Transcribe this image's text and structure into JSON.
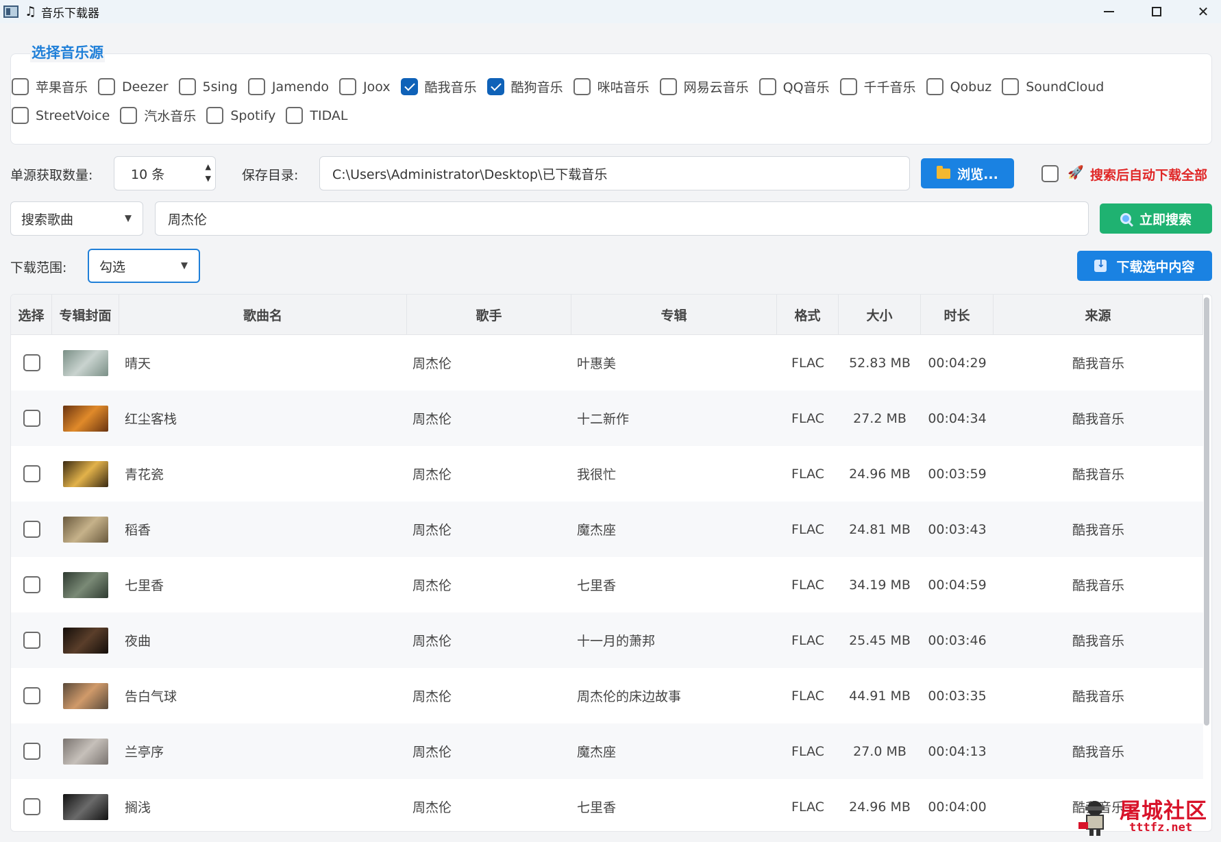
{
  "window": {
    "title": "音乐下载器"
  },
  "sources": {
    "title": "选择音乐源",
    "items": [
      {
        "label": "苹果音乐",
        "checked": false
      },
      {
        "label": "Deezer",
        "checked": false
      },
      {
        "label": "5sing",
        "checked": false
      },
      {
        "label": "Jamendo",
        "checked": false
      },
      {
        "label": "Joox",
        "checked": false
      },
      {
        "label": "酷我音乐",
        "checked": true
      },
      {
        "label": "酷狗音乐",
        "checked": true
      },
      {
        "label": "咪咕音乐",
        "checked": false
      },
      {
        "label": "网易云音乐",
        "checked": false
      },
      {
        "label": "QQ音乐",
        "checked": false
      },
      {
        "label": "千千音乐",
        "checked": false
      },
      {
        "label": "Qobuz",
        "checked": false
      },
      {
        "label": "SoundCloud",
        "checked": false
      },
      {
        "label": "StreetVoice",
        "checked": false
      },
      {
        "label": "汽水音乐",
        "checked": false
      },
      {
        "label": "Spotify",
        "checked": false
      },
      {
        "label": "TIDAL",
        "checked": false
      }
    ]
  },
  "settings": {
    "count_label": "单源获取数量:",
    "count_value": "10 条",
    "dir_label": "保存目录:",
    "dir_value": "C:\\Users\\Administrator\\Desktop\\已下载音乐",
    "browse_label": "浏览...",
    "auto_download_label": "搜索后自动下载全部",
    "auto_download_checked": false
  },
  "search": {
    "type_value": "搜索歌曲",
    "query": "周杰伦",
    "search_button": "立即搜索"
  },
  "download": {
    "range_label": "下载范围:",
    "range_value": "勾选",
    "download_button": "下载选中内容"
  },
  "table": {
    "headers": [
      "选择",
      "专辑封面",
      "歌曲名",
      "歌手",
      "专辑",
      "格式",
      "大小",
      "时长",
      "来源"
    ],
    "rows": [
      {
        "title": "晴天",
        "artist": "周杰伦",
        "album": "叶惠美",
        "format": "FLAC",
        "size": "52.83 MB",
        "duration": "00:04:29",
        "source": "酷我音乐",
        "cover_colors": [
          "#7a8f86",
          "#c9d3cf"
        ]
      },
      {
        "title": "红尘客栈",
        "artist": "周杰伦",
        "album": "十二新作",
        "format": "FLAC",
        "size": "27.2 MB",
        "duration": "00:04:34",
        "source": "酷我音乐",
        "cover_colors": [
          "#6a3410",
          "#e08a2a"
        ]
      },
      {
        "title": "青花瓷",
        "artist": "周杰伦",
        "album": "我很忙",
        "format": "FLAC",
        "size": "24.96 MB",
        "duration": "00:03:59",
        "source": "酷我音乐",
        "cover_colors": [
          "#3a2a12",
          "#e2b24a"
        ]
      },
      {
        "title": "稻香",
        "artist": "周杰伦",
        "album": "魔杰座",
        "format": "FLAC",
        "size": "24.81 MB",
        "duration": "00:03:43",
        "source": "酷我音乐",
        "cover_colors": [
          "#6a5a3e",
          "#c6b28a"
        ]
      },
      {
        "title": "七里香",
        "artist": "周杰伦",
        "album": "七里香",
        "format": "FLAC",
        "size": "34.19 MB",
        "duration": "00:04:59",
        "source": "酷我音乐",
        "cover_colors": [
          "#2e3a30",
          "#7a8a76"
        ]
      },
      {
        "title": "夜曲",
        "artist": "周杰伦",
        "album": "十一月的萧邦",
        "format": "FLAC",
        "size": "25.45 MB",
        "duration": "00:03:46",
        "source": "酷我音乐",
        "cover_colors": [
          "#140e0a",
          "#5a3e2a"
        ]
      },
      {
        "title": "告白气球",
        "artist": "周杰伦",
        "album": "周杰伦的床边故事",
        "format": "FLAC",
        "size": "44.91 MB",
        "duration": "00:03:35",
        "source": "酷我音乐",
        "cover_colors": [
          "#5a4a3a",
          "#d09a6a"
        ]
      },
      {
        "title": "兰亭序",
        "artist": "周杰伦",
        "album": "魔杰座",
        "format": "FLAC",
        "size": "27.0 MB",
        "duration": "00:04:13",
        "source": "酷我音乐",
        "cover_colors": [
          "#7a7470",
          "#c6c0ba"
        ]
      },
      {
        "title": "搁浅",
        "artist": "周杰伦",
        "album": "七里香",
        "format": "FLAC",
        "size": "24.96 MB",
        "duration": "00:04:00",
        "source": "酷我音乐",
        "cover_colors": [
          "#121212",
          "#6a6a6a"
        ]
      }
    ]
  },
  "watermark": {
    "line1": "屠城社区",
    "line2": "tttfz.net"
  }
}
